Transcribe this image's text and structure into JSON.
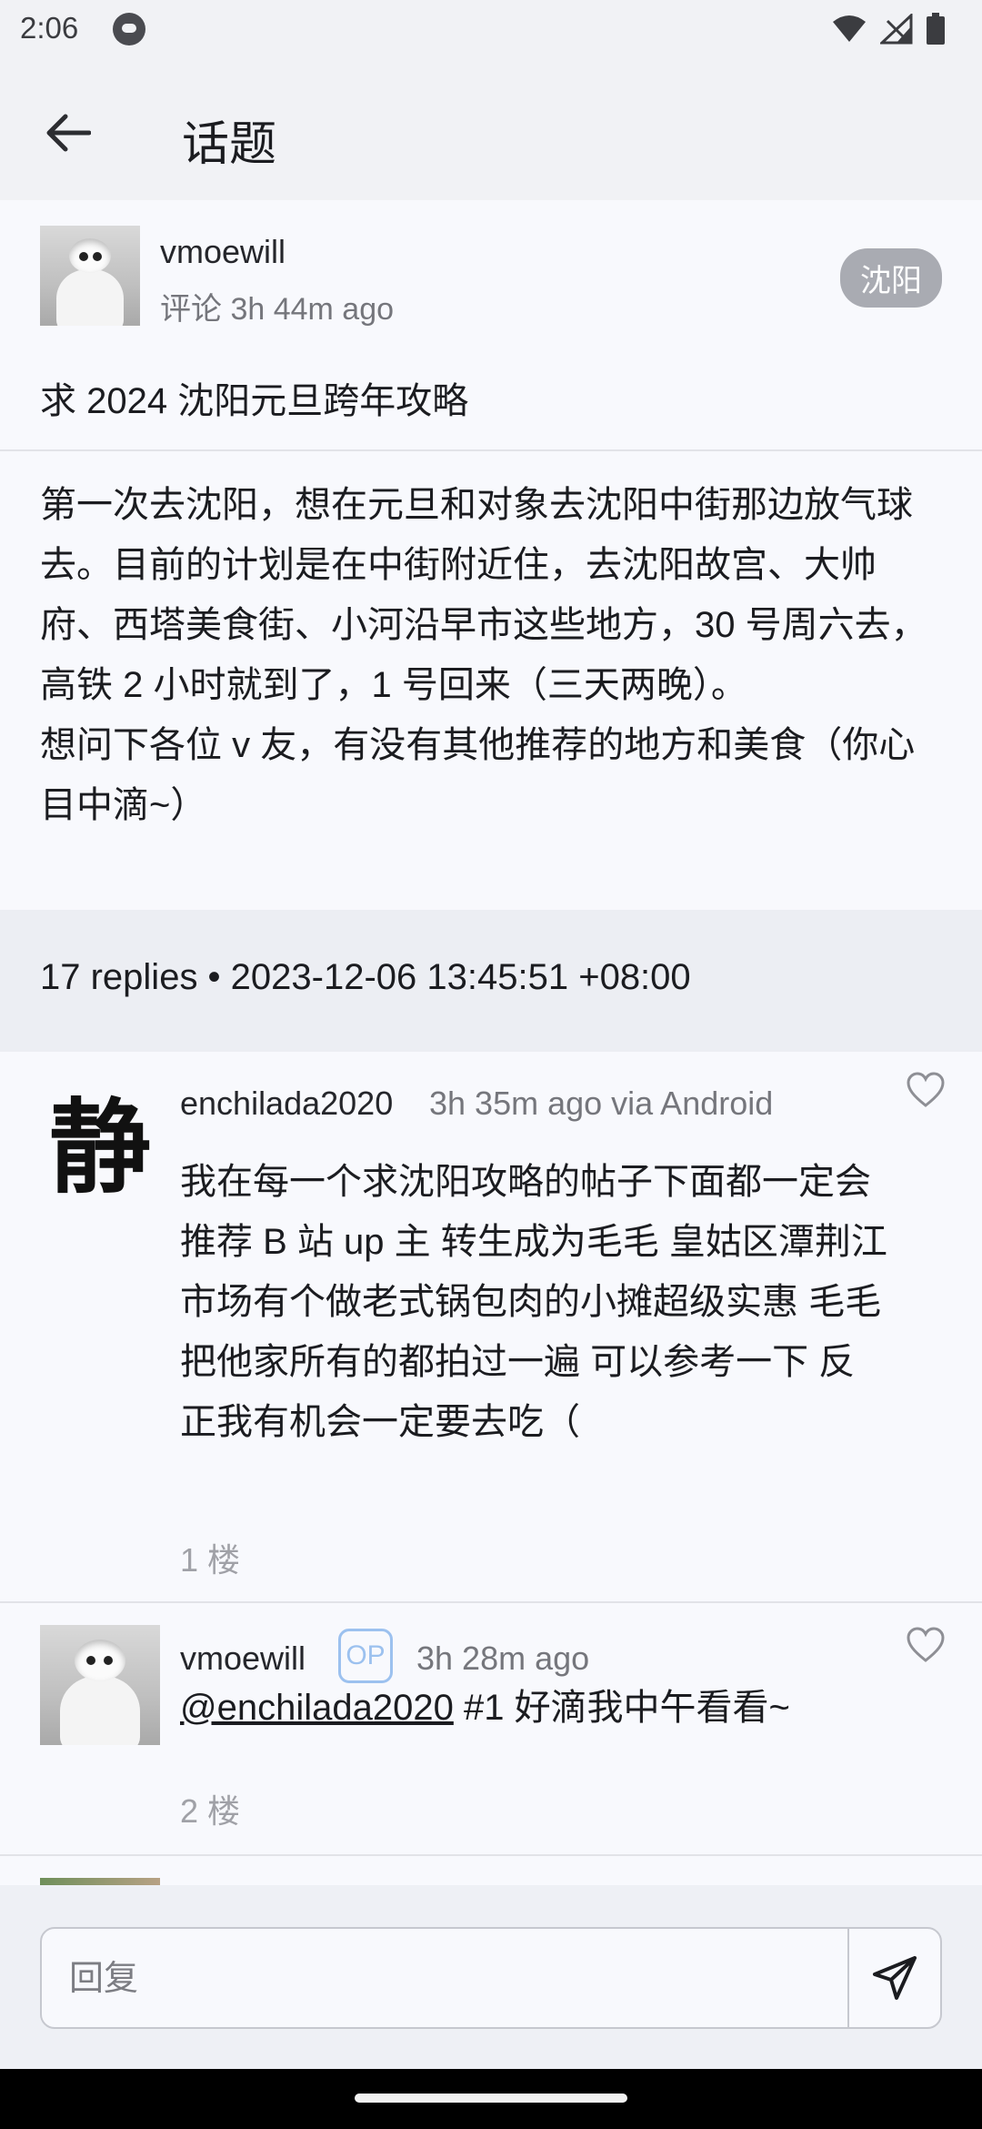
{
  "status_bar": {
    "time": "2:06"
  },
  "app_bar": {
    "title": "话题"
  },
  "topic": {
    "author": "vmoewill",
    "meta": "评论 3h 44m ago",
    "node": "沈阳",
    "title": "求 2024 沈阳元旦跨年攻略",
    "body": "第一次去沈阳，想在元旦和对象去沈阳中街那边放气球去。目前的计划是在中街附近住，去沈阳故宫、大帅府、西塔美食街、小河沿早市这些地方，30 号周六去，高铁 2 小时就到了，1 号回来（三天两晚）。\n想问下各位 v 友，有没有其他推荐的地方和美食（你心目中滴~）"
  },
  "stats": {
    "text": "17 replies  •  2023-12-06 13:45:51 +08:00"
  },
  "replies": [
    {
      "author": "enchilada2020",
      "avatar_char": "静",
      "meta": "3h 35m ago via Android",
      "body": "我在每一个求沈阳攻略的帖子下面都一定会推荐 B 站 up 主 转生成为毛毛 皇姑区潭荆江市场有个做老式锅包肉的小摊超级实惠 毛毛把他家所有的都拍过一遍 可以参考一下 反正我有机会一定要去吃（",
      "floor": "1 楼"
    },
    {
      "author": "vmoewill",
      "op_badge": "OP",
      "meta": "3h 28m ago",
      "mention": "@enchilada2020",
      "body": " #1 好滴我中午看看~",
      "floor": "2 楼"
    }
  ],
  "reply_input": {
    "placeholder": "回复"
  }
}
